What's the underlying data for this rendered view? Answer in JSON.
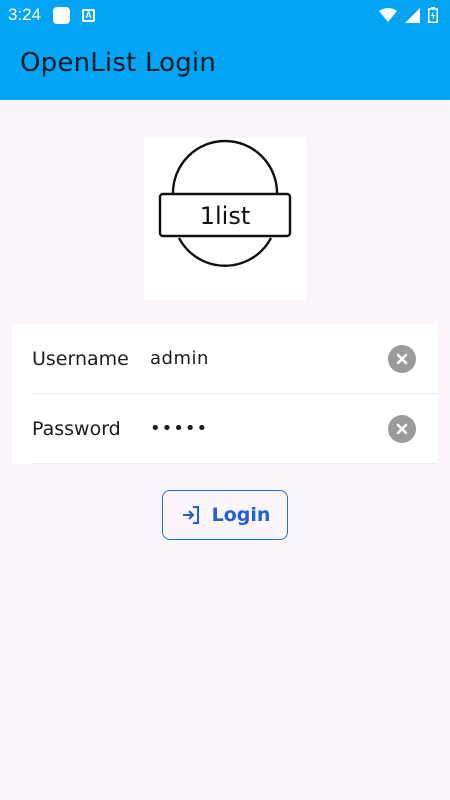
{
  "status_bar": {
    "time": "3:24",
    "icons": [
      "app-notification-icon",
      "a-notification-icon",
      "wifi-icon",
      "signal-icon",
      "battery-icon"
    ]
  },
  "app_bar": {
    "title": "OpenList Login",
    "color": "#04a4f4"
  },
  "logo": {
    "text": "1list"
  },
  "form": {
    "username": {
      "label": "Username",
      "value": "admin"
    },
    "password": {
      "label": "Password",
      "value": "•••••"
    }
  },
  "login_button": {
    "label": "Login",
    "icon": "login-icon",
    "color": "#1f5fd0"
  },
  "background_color": "#fcf5fc"
}
